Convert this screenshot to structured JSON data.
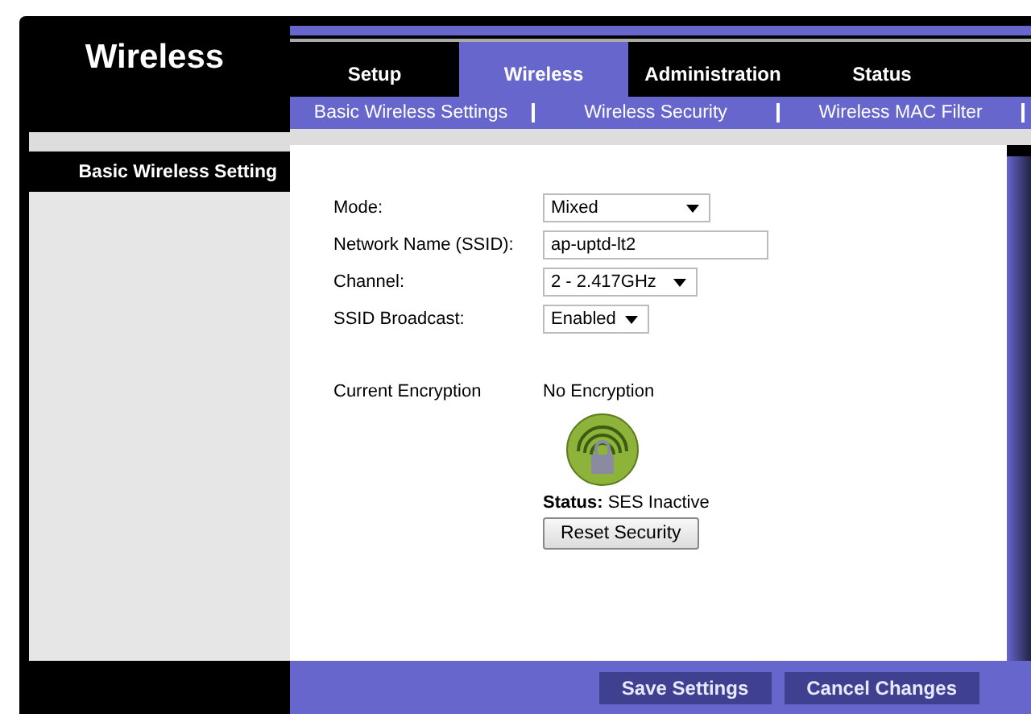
{
  "page_title": "Wireless",
  "tabs": [
    {
      "label": "Setup",
      "selected": false
    },
    {
      "label": "Wireless",
      "selected": true
    },
    {
      "label": "Administration",
      "selected": false
    },
    {
      "label": "Status",
      "selected": false
    }
  ],
  "subtabs": [
    {
      "label": "Basic Wireless Settings"
    },
    {
      "label": "Wireless Security"
    },
    {
      "label": "Wireless MAC Filter"
    }
  ],
  "section_title": "Basic Wireless Setting",
  "fields": [
    {
      "label": "Mode:",
      "kind": "select",
      "value": "Mixed"
    },
    {
      "label": "Network Name (SSID):",
      "kind": "text",
      "value": "ap-uptd-lt2"
    },
    {
      "label": "Channel:",
      "kind": "select",
      "value": "2 - 2.417GHz"
    },
    {
      "label": "SSID Broadcast:",
      "kind": "select",
      "value": "Enabled"
    }
  ],
  "encryption": {
    "label": "Current Encryption",
    "value": "No Encryption",
    "status": "**Status:** SES Inactive",
    "button": "Reset Security"
  },
  "buttons": [
    "Save Settings",
    "Cancel Changes"
  ]
}
